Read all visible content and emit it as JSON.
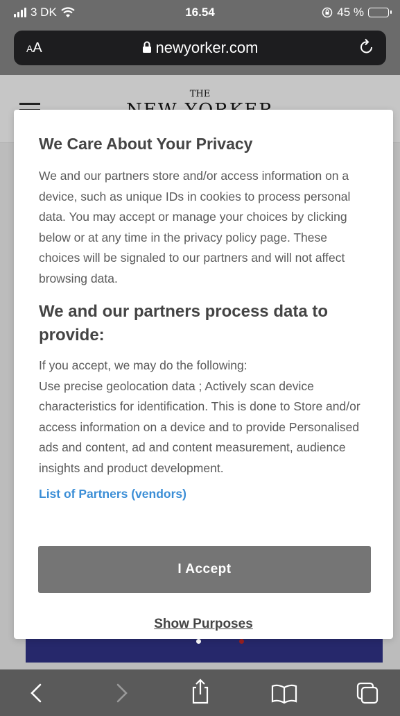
{
  "status_bar": {
    "carrier": "3 DK",
    "time": "16.54",
    "battery": "45 %",
    "battery_level": 0.45
  },
  "address_bar": {
    "text_size_label": "AA",
    "url": "newyorker.com"
  },
  "site": {
    "logo_small": "THE",
    "logo": "NEW YORKER"
  },
  "consent": {
    "title": "We Care About Your Privacy",
    "intro": "We and our partners store and/or access information on a device, such as unique IDs in cookies to process personal data. You may accept or manage your choices by clicking below or at any time in the privacy policy page. These choices will be signaled to our partners and will not affect browsing data.",
    "subtitle": "We and our partners process data to provide:",
    "details_line1": "If you accept, we may do the following:",
    "details_line2": "Use precise geolocation data ; Actively scan device characteristics for identification. This is done to Store and/or access information on a device and to provide Personalised ads and content, ad and content measurement, audience insights and product development.",
    "partners_link": "List of Partners (vendors)",
    "accept_label": "I Accept",
    "purposes_label": "Show Purposes"
  },
  "toolbar": {
    "back": "‹",
    "forward": "›"
  }
}
